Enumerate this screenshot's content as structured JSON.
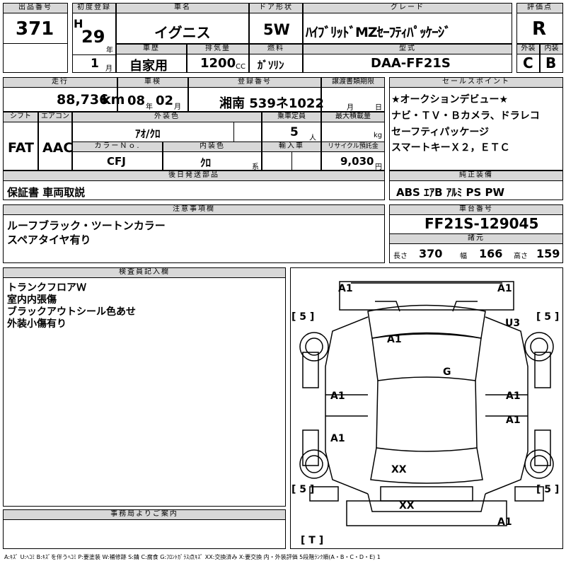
{
  "lot": {
    "label": "出品番号",
    "value": "371"
  },
  "first_reg": {
    "label": "初度登録",
    "era": "H",
    "year": "29",
    "year_unit": "年",
    "month": "1",
    "month_unit": "月"
  },
  "car_name": {
    "label": "車名",
    "value": "イグニス"
  },
  "door": {
    "label": "ドア形状",
    "value": "5W"
  },
  "grade": {
    "label": "グレード",
    "value": "ﾊｲﾌﾞﾘｯﾄﾞMZｾｰﾌﾃｨﾊﾟｯｹｰｼﾞ"
  },
  "score": {
    "label": "評価点",
    "value": "R",
    "ext_label": "外装",
    "int_label": "内装",
    "ext": "C",
    "int": "B"
  },
  "history": {
    "label": "車歴",
    "value": "自家用"
  },
  "displacement": {
    "label": "排気量",
    "value": "1200",
    "unit": "CC"
  },
  "fuel": {
    "label": "燃料",
    "value": "ｶﾞｿﾘﾝ"
  },
  "model_code": {
    "label": "型式",
    "value": "DAA-FF21S"
  },
  "mileage": {
    "label": "走行",
    "value": "88,736",
    "unit": "km"
  },
  "inspection": {
    "label": "車検",
    "year": "08",
    "year_unit": "年",
    "month": "02",
    "month_unit": "月"
  },
  "plate": {
    "label": "登録番号",
    "value": "湘南 539ネ1022"
  },
  "transfer": {
    "label": "譲渡書類期限",
    "month_unit": "月",
    "day_unit": "日"
  },
  "sales_points": {
    "label": "セールスポイント",
    "lines": [
      "★オークションデビュー★",
      "ナビ・ＴＶ・Ｂカメラ、ドラレコ",
      "セーフティパッケージ",
      "スマートキーＸ２，ＥＴＣ"
    ]
  },
  "shift": {
    "label": "シフト",
    "value": "FAT"
  },
  "aircon": {
    "label": "エアコン",
    "value": "AAC"
  },
  "ext_color": {
    "label": "外装色",
    "value": "ｱｵ/ｸﾛ"
  },
  "capacity": {
    "label": "乗車定員",
    "value": "5",
    "unit": "人"
  },
  "max_load": {
    "label": "最大積載量",
    "unit": "kg"
  },
  "color_no": {
    "label": "カラーＮｏ.",
    "value": "CFJ"
  },
  "int_color": {
    "label": "内装色",
    "value": "ｸﾛ",
    "unit": "系"
  },
  "import": {
    "label": "輸入車"
  },
  "recycle": {
    "label": "リサイクル預託金",
    "value": "9,030",
    "unit": "円"
  },
  "later_parts": {
    "label": "後日発送部品",
    "value": "保証書 車両取説"
  },
  "equipment": {
    "label": "純正装備",
    "value": "ABS ｴｱB ｱﾙﾐ PS PW"
  },
  "notes": {
    "label": "注意事項欄",
    "lines": [
      "ルーフブラック・ツートンカラー",
      "スペアタイヤ有り"
    ]
  },
  "chassis": {
    "label": "車台番号",
    "value": "FF21S-129045"
  },
  "specs": {
    "label": "諸元",
    "length_label": "長さ",
    "length": "370",
    "width_label": "幅",
    "width": "166",
    "height_label": "高さ",
    "height": "159"
  },
  "inspector": {
    "label": "検査員記入欄",
    "lines": [
      "トランクフロアＷ",
      "室内内張傷",
      "ブラックアウトシール色あせ",
      "外装小傷有り"
    ]
  },
  "office": {
    "label": "事務局よりご案内"
  },
  "diagram": {
    "marks": {
      "front_left": "A1",
      "front_right": "A1",
      "right_front_fender": "U3",
      "hood": "A1",
      "windshield": "G",
      "left_front_door": "A1",
      "right_front_door": "A1",
      "left_rear_door": "A1",
      "right_rear_door": "A1",
      "rear_glass": "XX",
      "rear_bumper_area": "XX",
      "rear_right": "A1"
    },
    "tires": {
      "front_left": "[ 5 ]",
      "front_right": "[ 5 ]",
      "rear_left": "[ 5 ]",
      "rear_right": "[ 5 ]",
      "spare": "[ T ]"
    }
  },
  "legend": "A:ｷｽﾞ U:ﾍｺﾐ B:ｷｽﾞを伴うﾍｺﾐ P:要塗装 W:補修跡 S:錆 C:腐食 G:ﾌﾛﾝﾄｶﾞﾗｽ点ｷｽﾞ XX:交換済み X:要交換 内・外装評価 5段階ﾗﾝｸ順(A・B・C・D・E) 1"
}
